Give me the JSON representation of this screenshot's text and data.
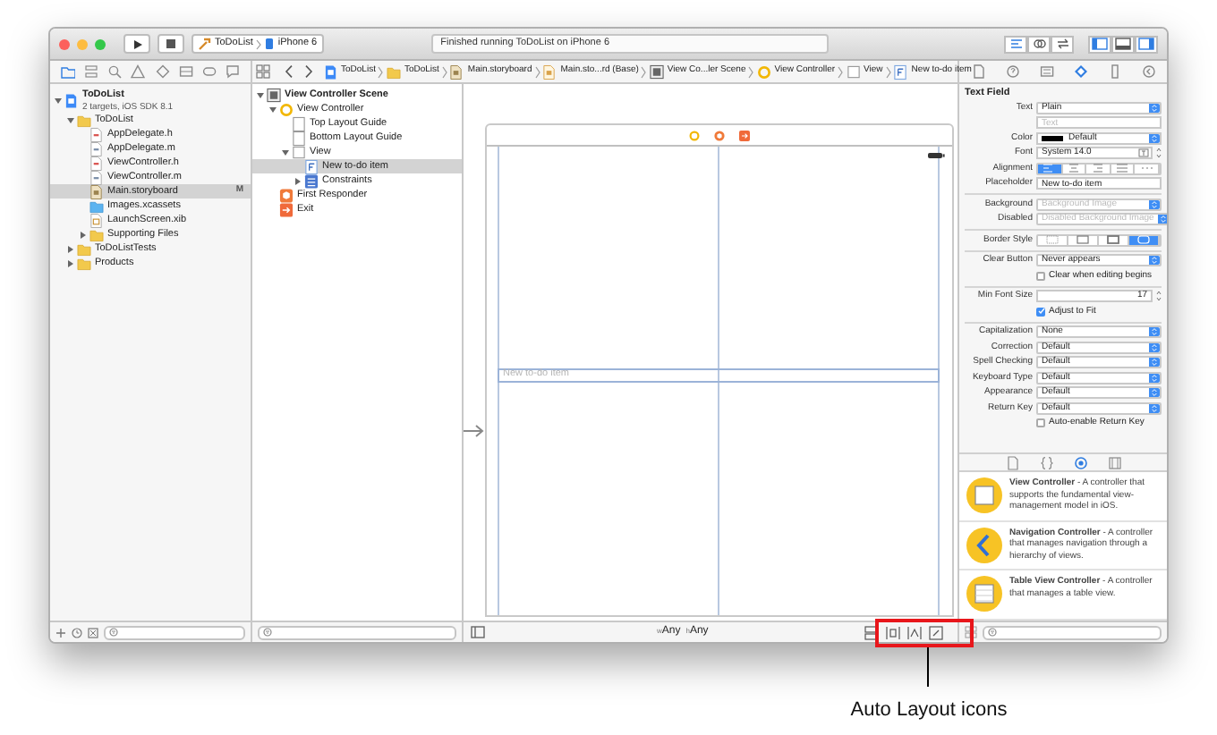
{
  "toolbar": {
    "scheme": [
      {
        "kind": "app",
        "label": "ToDoList"
      },
      {
        "kind": "device",
        "label": "iPhone 6"
      }
    ],
    "status": "Finished running ToDoList on iPhone 6",
    "editor_modes": [
      {
        "selected": true
      },
      {
        "selected": false
      },
      {
        "selected": false
      }
    ],
    "panels": [
      {
        "on": true
      },
      {
        "on": false
      },
      {
        "on": true
      }
    ]
  },
  "navigator_tabs": [
    {
      "selected": true
    },
    {
      "selected": false
    },
    {
      "selected": false
    },
    {
      "selected": false
    },
    {
      "selected": false
    },
    {
      "selected": false
    },
    {
      "selected": false
    },
    {
      "selected": false
    }
  ],
  "jump_bar": [
    {
      "kind": "project",
      "label": "ToDoList"
    },
    {
      "kind": "folder",
      "label": "ToDoList"
    },
    {
      "kind": "storyboard",
      "label": "Main.storyboard"
    },
    {
      "kind": "storyboard-base",
      "label": "Main.sto...rd (Base)"
    },
    {
      "kind": "scene",
      "label": "View Co...ler Scene"
    },
    {
      "kind": "controller",
      "label": "View Controller"
    },
    {
      "kind": "view",
      "label": "View"
    },
    {
      "kind": "textfield",
      "label": "New to-do item"
    }
  ],
  "inspector_tabs": [
    {
      "selected": false
    },
    {
      "selected": false
    },
    {
      "selected": false
    },
    {
      "selected": true
    },
    {
      "selected": false
    },
    {
      "selected": false
    }
  ],
  "navigator": {
    "tree": [
      {
        "kind": "project",
        "label": "ToDoList",
        "subtitle": "2 targets, iOS SDK 8.1",
        "expanded": true,
        "selected": false,
        "children": [
          {
            "kind": "folder",
            "label": "ToDoList",
            "expanded": true,
            "selected": false,
            "children": [
              {
                "kind": "header",
                "label": "AppDelegate.h",
                "selected": false
              },
              {
                "kind": "source",
                "label": "AppDelegate.m",
                "selected": false
              },
              {
                "kind": "header",
                "label": "ViewController.h",
                "selected": false
              },
              {
                "kind": "source",
                "label": "ViewController.m",
                "selected": false
              },
              {
                "kind": "storyboard",
                "label": "Main.storyboard",
                "selected": true,
                "badge": "M"
              },
              {
                "kind": "assets",
                "label": "Images.xcassets",
                "selected": false
              },
              {
                "kind": "xib",
                "label": "LaunchScreen.xib",
                "selected": false
              },
              {
                "kind": "folder",
                "label": "Supporting Files",
                "expanded": false,
                "selected": false
              }
            ]
          },
          {
            "kind": "folder",
            "label": "ToDoListTests",
            "expanded": false,
            "selected": false
          },
          {
            "kind": "folder",
            "label": "Products",
            "expanded": false,
            "selected": false
          }
        ]
      }
    ]
  },
  "outline": {
    "tree": [
      {
        "kind": "scene",
        "label": "View Controller Scene",
        "expanded": true,
        "selected": false,
        "children": [
          {
            "kind": "controller",
            "label": "View Controller",
            "expanded": true,
            "selected": false,
            "children": [
              {
                "kind": "guide",
                "label": "Top Layout Guide",
                "selected": false
              },
              {
                "kind": "guide",
                "label": "Bottom Layout Guide",
                "selected": false
              },
              {
                "kind": "view",
                "label": "View",
                "expanded": true,
                "selected": false,
                "children": [
                  {
                    "kind": "textfield",
                    "label": "New to-do item",
                    "selected": true
                  },
                  {
                    "kind": "constraints",
                    "label": "Constraints",
                    "expanded": false,
                    "selected": false
                  }
                ]
              }
            ]
          },
          {
            "kind": "responder",
            "label": "First Responder",
            "selected": false
          },
          {
            "kind": "exit",
            "label": "Exit",
            "selected": false
          }
        ]
      }
    ]
  },
  "canvas": {
    "text_field": {
      "placeholder": "New to-do item"
    },
    "size_classes": [
      {
        "prefix": "w",
        "value": "Any"
      },
      {
        "prefix": "h",
        "value": "Any"
      }
    ]
  },
  "inspector": {
    "title": "Text Field",
    "rows": [
      {
        "kind": "select",
        "label": "Text",
        "value": "Plain"
      },
      {
        "kind": "field",
        "placeholder": "Text"
      },
      {
        "kind": "color",
        "label": "Color",
        "value": "Default"
      },
      {
        "kind": "font",
        "label": "Font",
        "value": "System 14.0"
      },
      {
        "kind": "segmented",
        "label": "Alignment",
        "segments": [
          {
            "selected": true
          },
          {
            "selected": false
          },
          {
            "selected": false
          },
          {
            "selected": false
          },
          {
            "selected": false
          }
        ]
      },
      {
        "kind": "field",
        "label": "Placeholder",
        "value": "New to-do item"
      },
      {
        "kind": "separator"
      },
      {
        "kind": "select",
        "label": "Background",
        "placeholder": "Background Image"
      },
      {
        "kind": "select",
        "label": "Disabled",
        "placeholder": "Disabled Background Image"
      },
      {
        "kind": "separator"
      },
      {
        "kind": "segmented",
        "label": "Border Style",
        "segments": [
          {
            "selected": false
          },
          {
            "selected": false
          },
          {
            "selected": false
          },
          {
            "selected": true
          }
        ]
      },
      {
        "kind": "separator"
      },
      {
        "kind": "select",
        "label": "Clear Button",
        "value": "Never appears"
      },
      {
        "kind": "checkbox",
        "text": "Clear when editing begins",
        "checked": false
      },
      {
        "kind": "separator"
      },
      {
        "kind": "stepper",
        "label": "Min Font Size",
        "value": "17"
      },
      {
        "kind": "checkbox",
        "text": "Adjust to Fit",
        "checked": true
      },
      {
        "kind": "separator"
      },
      {
        "kind": "select",
        "label": "Capitalization",
        "value": "None"
      },
      {
        "kind": "select",
        "label": "Correction",
        "value": "Default"
      },
      {
        "kind": "select",
        "label": "Spell Checking",
        "value": "Default"
      },
      {
        "kind": "select",
        "label": "Keyboard Type",
        "value": "Default"
      },
      {
        "kind": "select",
        "label": "Appearance",
        "value": "Default"
      },
      {
        "kind": "select",
        "label": "Return Key",
        "value": "Default"
      },
      {
        "kind": "checkbox",
        "text": "Auto-enable Return Key",
        "checked": false
      }
    ]
  },
  "library": {
    "tabs": [
      {
        "selected": false
      },
      {
        "selected": false
      },
      {
        "selected": true
      },
      {
        "selected": false
      }
    ],
    "items": [
      {
        "kind": "view-controller",
        "text": "**View Controller** - A controller that supports the fundamental view-management model in iOS."
      },
      {
        "kind": "navigation-controller",
        "text": "**Navigation Controller** - A controller that manages navigation through a hierarchy of views."
      },
      {
        "kind": "table-view-controller",
        "text": "**Table View Controller** - A controller that manages a table view."
      }
    ]
  },
  "annotation": {
    "label": "Auto Layout icons"
  }
}
